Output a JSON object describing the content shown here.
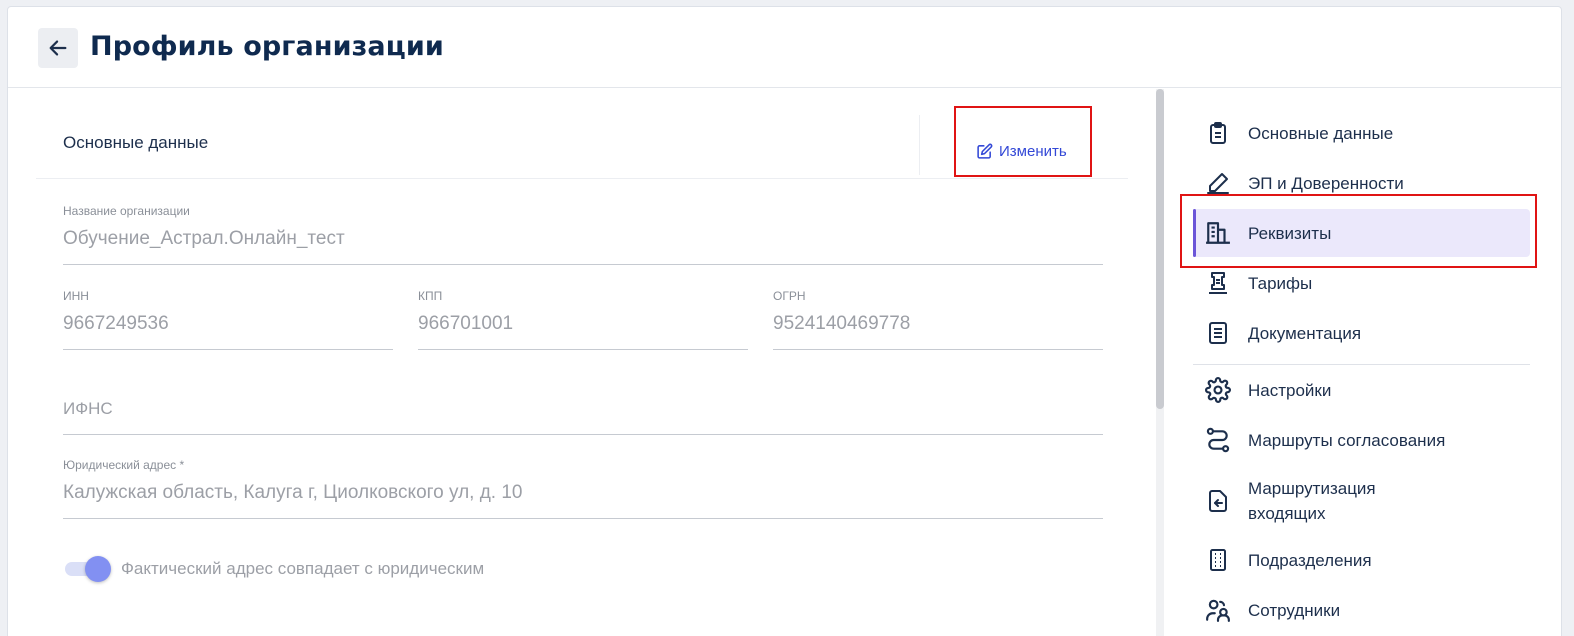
{
  "header": {
    "title": "Профиль организации",
    "back_icon": "arrow-left-icon"
  },
  "section": {
    "title": "Основные данные",
    "edit_label": "Изменить",
    "edit_icon": "edit-icon"
  },
  "fields": {
    "org_name": {
      "label": "Название организации",
      "value": "Обучение_Астрал.Онлайн_тест"
    },
    "inn": {
      "label": "ИНН",
      "value": "9667249536"
    },
    "kpp": {
      "label": "КПП",
      "value": "966701001"
    },
    "ogrn": {
      "label": "ОГРН",
      "value": "9524140469778"
    },
    "ifns": {
      "placeholder": "ИФНС"
    },
    "legal_address": {
      "label": "Юридический адрес *",
      "value": "Калужская область, Калуга г, Циолковского ул, д. 10"
    }
  },
  "toggle": {
    "label": "Фактический адрес совпадает с юридическим",
    "on": true
  },
  "sidenav": {
    "items": [
      {
        "label": "Основные данные",
        "icon": "clipboard-icon"
      },
      {
        "label": "ЭП и Доверенности",
        "icon": "pen-icon"
      },
      {
        "label": "Реквизиты",
        "icon": "building-icon",
        "active": true
      },
      {
        "label": "Тарифы",
        "icon": "tariff-icon"
      },
      {
        "label": "Документация",
        "icon": "document-icon"
      },
      {
        "label": "Настройки",
        "icon": "gear-icon"
      },
      {
        "label": "Маршруты согласования",
        "icon": "route-icon"
      },
      {
        "label": "Маршрутизация входящих",
        "icon": "incoming-icon"
      },
      {
        "label": "Подразделения",
        "icon": "departments-icon"
      },
      {
        "label": "Сотрудники",
        "icon": "users-icon"
      }
    ]
  },
  "colors": {
    "accent": "#3348d6",
    "title": "#0f2a4f",
    "active_bg": "#ebe8fb",
    "highlight": "#e01414"
  }
}
